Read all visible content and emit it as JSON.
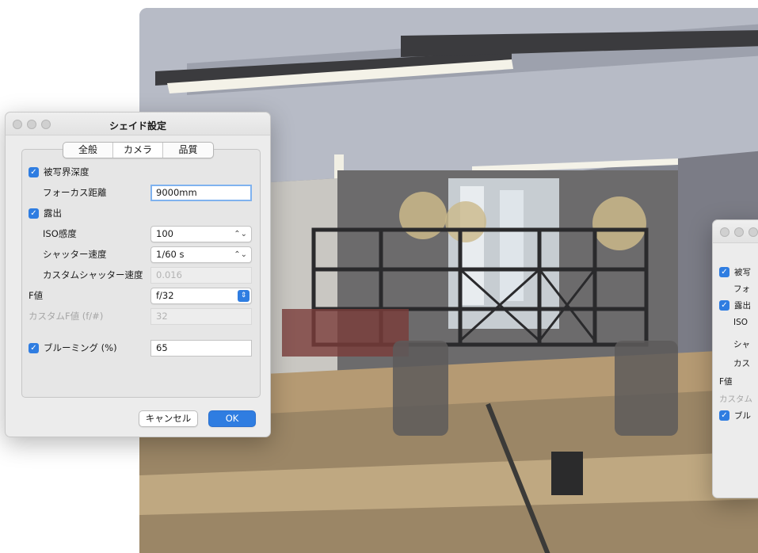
{
  "dialog": {
    "title": "シェイド設定",
    "tabs": [
      {
        "label": "全般"
      },
      {
        "label": "カメラ"
      },
      {
        "label": "品質"
      }
    ],
    "active_tab": "カメラ",
    "depth_of_field": {
      "label": "被写界深度",
      "checked": true
    },
    "focus_distance": {
      "label": "フォーカス距離",
      "value": "9000mm"
    },
    "exposure": {
      "label": "露出",
      "checked": true
    },
    "iso": {
      "label": "ISO感度",
      "value": "100"
    },
    "shutter_speed": {
      "label": "シャッター速度",
      "value": "1/60 s"
    },
    "custom_shutter": {
      "label": "カスタムシャッター速度",
      "value": "0.016"
    },
    "f_number": {
      "label": "F値",
      "value": "f/32"
    },
    "custom_f": {
      "label": "カスタムF値 (f/#)",
      "value": "32"
    },
    "blooming": {
      "label": "ブルーミング (%)",
      "checked": true,
      "value": "65"
    },
    "cancel_label": "キャンセル",
    "ok_label": "OK"
  },
  "second_dialog": {
    "rows": [
      {
        "text": "被写"
      },
      {
        "text": "フォ"
      },
      {
        "text": "露出"
      },
      {
        "text": "ISO"
      },
      {
        "text": "シャ"
      },
      {
        "text": "カス"
      },
      {
        "text": "F値"
      },
      {
        "text": "カスタム"
      },
      {
        "text": "ブル"
      }
    ]
  },
  "colors": {
    "accent": "#2f7de1",
    "window_bg": "#ececec"
  },
  "icons": {
    "checkbox": "checkmark-icon",
    "select": "updown-chevron-icon"
  }
}
